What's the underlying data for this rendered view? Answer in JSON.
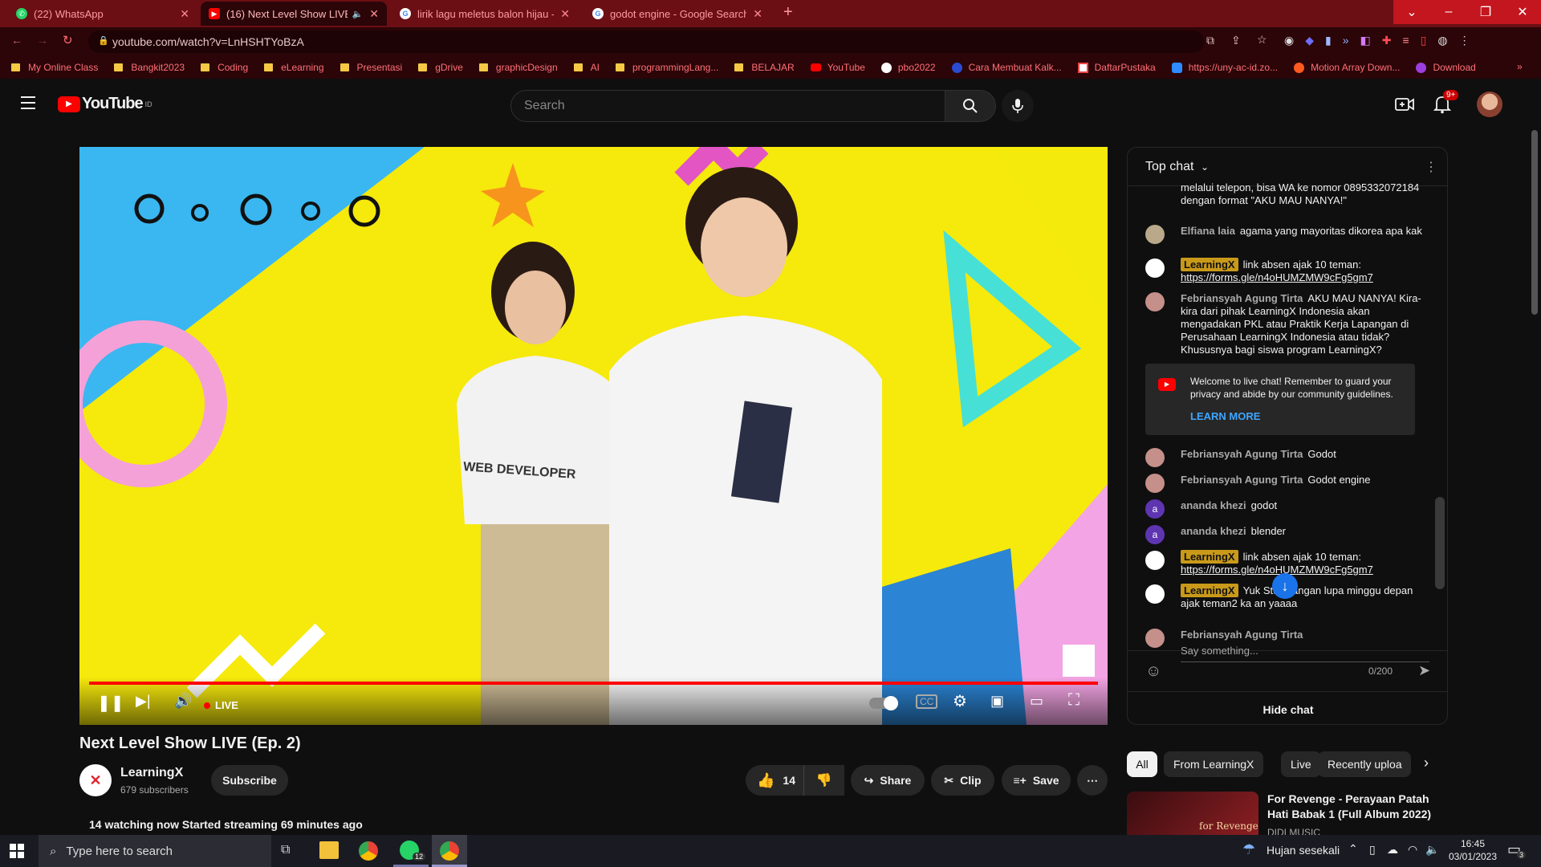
{
  "browser": {
    "tabs": [
      {
        "label": "(22) WhatsApp",
        "active": false
      },
      {
        "label": "(16) Next Level Show LIVE (E",
        "active": true
      },
      {
        "label": "lirik lagu meletus balon hijau - G",
        "active": false
      },
      {
        "label": "godot engine - Google Search",
        "active": false
      }
    ],
    "new_tab": "+",
    "url": "youtube.com/watch?v=LnHSHTYoBzA",
    "bookmarks": [
      "My Online Class",
      "Bangkit2023",
      "Coding",
      "eLearning",
      "Presentasi",
      "gDrive",
      "graphicDesign",
      "AI",
      "programmingLang...",
      "BELAJAR",
      "YouTube",
      "pbo2022",
      "Cara Membuat Kalk...",
      "DaftarPustaka",
      "https://uny-ac-id.zo...",
      "Motion Array Down...",
      "Download"
    ]
  },
  "youtube": {
    "logo_text": "YouTube",
    "logo_sup": "ID",
    "search_placeholder": "Search",
    "notif_count": "9+",
    "video": {
      "title": "Next Level Show LIVE (Ep. 2)",
      "live_label": "LIVE",
      "shirt_text": "WEB DEVELOPER",
      "progress": 1.0
    },
    "channel": {
      "name": "LearningX",
      "subscribers": "679 subscribers",
      "subscribe": "Subscribe"
    },
    "actions": {
      "likes": "14",
      "share": "Share",
      "clip": "Clip",
      "save": "Save"
    },
    "stats": "14 watching now  Started streaming 69 minutes ago"
  },
  "chat": {
    "header": "Top chat",
    "partial_message": "melalui telepon, bisa WA ke nomor 0895332072184 dengan format \"AKU MAU NANYA!\"",
    "messages": [
      {
        "author": "Elfiana laia",
        "text": "agama yang mayoritas dikorea apa kak",
        "badge": false
      },
      {
        "author": "LearningX",
        "text": "link absen ajak 10 teman: ",
        "link": "https://forms.gle/n4oHUMZMW9cFg5gm7",
        "badge": true
      },
      {
        "author": "Febriansyah Agung Tirta",
        "text": "AKU MAU NANYA! Kira-kira dari pihak LearningX Indonesia akan mengadakan PKL atau Praktik Kerja Lapangan di Perusahaan LearningX Indonesia atau tidak? Khususnya bagi siswa program LearningX?",
        "badge": false
      },
      {
        "author": "Febriansyah Agung Tirta",
        "text": "Godot",
        "badge": false
      },
      {
        "author": "Febriansyah Agung Tirta",
        "text": "Godot engine",
        "badge": false
      },
      {
        "author": "ananda khezi",
        "text": "godot",
        "badge": false
      },
      {
        "author": "ananda khezi",
        "text": "blender",
        "badge": false
      },
      {
        "author": "LearningX",
        "text": "link absen ajak 10 teman: ",
        "link": "https://forms.gle/n4oHUMZMW9cFg5gm7",
        "badge": true
      },
      {
        "author": "LearningX",
        "text": "Yuk Stu  k jangan lupa minggu depan ajak teman2 ka  an yaaaa",
        "badge": true
      }
    ],
    "welcome_text": "Welcome to live chat! Remember to guard your privacy and abide by our community guidelines.",
    "learn_more": "LEARN MORE",
    "input_author": "Febriansyah Agung Tirta",
    "input_placeholder": "Say something...",
    "char_count": "0/200",
    "hide_chat": "Hide chat"
  },
  "chips": [
    "All",
    "From LearningX",
    "Live",
    "Recently uploa"
  ],
  "recommendation": {
    "title": "For Revenge - Perayaan Patah Hati Babak 1 (Full Album 2022)",
    "channel": "DIDI MUSIC",
    "thumb_text": "for Revenge"
  },
  "taskbar": {
    "search_placeholder": "Type here to search",
    "weather": "Hujan sesekali",
    "time": "16:45",
    "date": "03/01/2023",
    "whatsapp_badge": "12",
    "notif_badge": "3"
  },
  "colors": {
    "youtube_red": "#ff0000",
    "browser_tab_bg": "#6b0f14",
    "member_badge": "#c99a19",
    "link_blue": "#3ea6ff"
  }
}
